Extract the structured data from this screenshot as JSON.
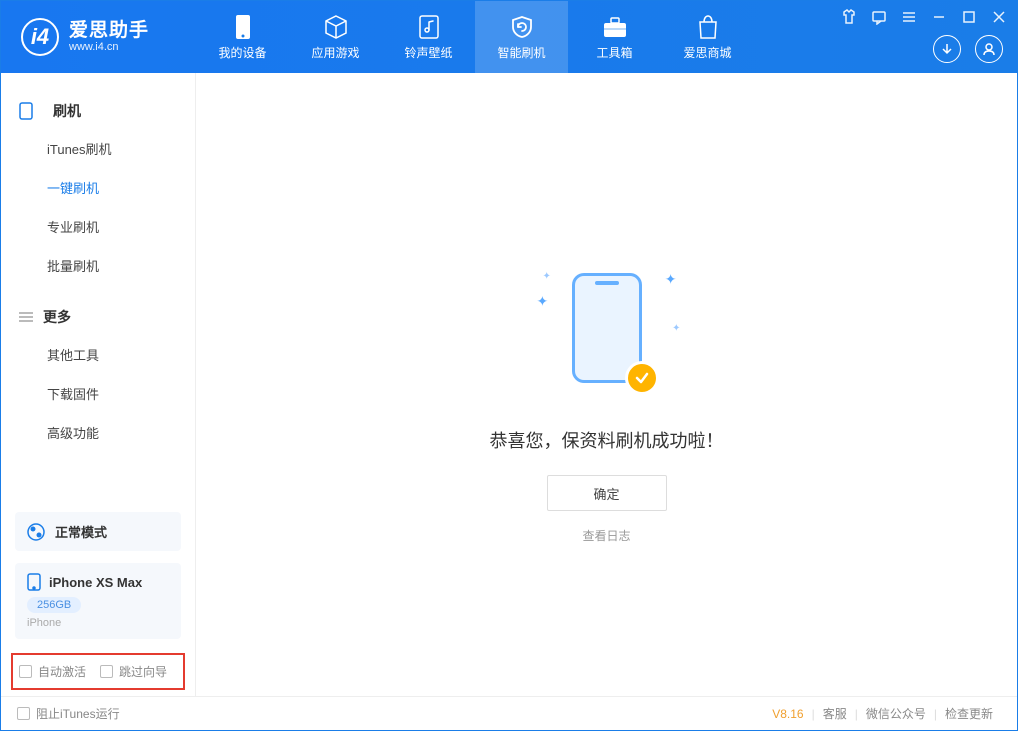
{
  "app": {
    "name": "爱思助手",
    "site": "www.i4.cn"
  },
  "nav": {
    "items": [
      {
        "label": "我的设备"
      },
      {
        "label": "应用游戏"
      },
      {
        "label": "铃声壁纸"
      },
      {
        "label": "智能刷机"
      },
      {
        "label": "工具箱"
      },
      {
        "label": "爱思商城"
      }
    ]
  },
  "sidebar": {
    "section1": {
      "title": "刷机",
      "items": [
        {
          "label": "iTunes刷机"
        },
        {
          "label": "一键刷机"
        },
        {
          "label": "专业刷机"
        },
        {
          "label": "批量刷机"
        }
      ]
    },
    "section2": {
      "title": "更多",
      "items": [
        {
          "label": "其他工具"
        },
        {
          "label": "下载固件"
        },
        {
          "label": "高级功能"
        }
      ]
    },
    "mode": "正常模式",
    "device": {
      "name": "iPhone XS Max",
      "storage": "256GB",
      "type": "iPhone"
    },
    "options": {
      "auto_activate": "自动激活",
      "skip_guide": "跳过向导"
    }
  },
  "main": {
    "success_text": "恭喜您，保资料刷机成功啦！",
    "confirm_label": "确定",
    "view_log": "查看日志"
  },
  "footer": {
    "block_itunes": "阻止iTunes运行",
    "version": "V8.16",
    "support": "客服",
    "wechat": "微信公众号",
    "check_update": "检查更新"
  }
}
